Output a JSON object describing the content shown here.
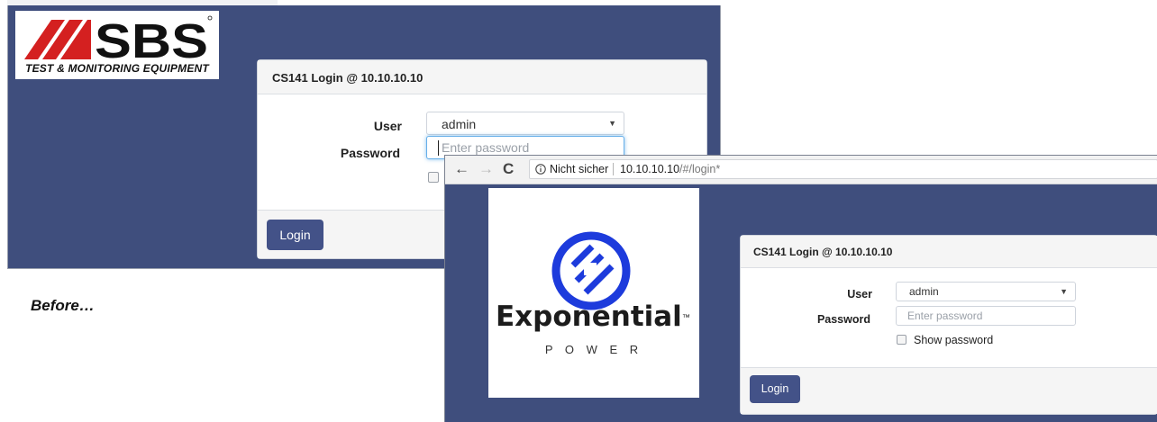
{
  "before": {
    "logo": {
      "brand": "SBS",
      "tagline": "TEST & MONITORING EQUIPMENT",
      "icon": "sbs-stripe-logo-icon"
    },
    "login": {
      "title": "CS141 Login @ 10.10.10.10",
      "user_label": "User",
      "user_value": "admin",
      "password_label": "Password",
      "password_placeholder": "Enter password",
      "login_button": "Login"
    }
  },
  "caption": "Before…",
  "after": {
    "browser": {
      "back_icon": "back-arrow-icon",
      "forward_icon": "forward-arrow-icon",
      "reload_icon": "reload-icon",
      "info_icon": "info-icon",
      "security_label": "Nicht sicher",
      "url_host": "10.10.10.10",
      "url_path": "/#/login*"
    },
    "logo": {
      "name": "Exponential",
      "trademark": "™",
      "sub": "P O W E R",
      "icon": "exponential-power-logo-icon"
    },
    "login": {
      "title": "CS141 Login @ 10.10.10.10",
      "user_label": "User",
      "user_value": "admin",
      "password_label": "Password",
      "password_placeholder": "Enter password",
      "show_password_label": "Show password",
      "login_button": "Login"
    }
  },
  "colors": {
    "background_panel": "#3f4e7d",
    "button": "#435288",
    "focus": "#66afe9",
    "exp_blue": "#1d3bdc"
  }
}
